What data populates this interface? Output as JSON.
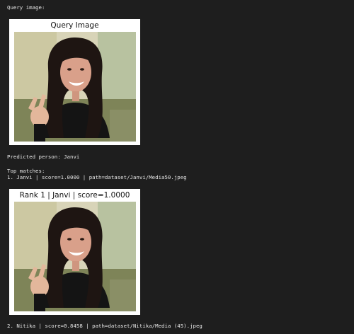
{
  "output": {
    "query_label": "Query image:",
    "query_figure": {
      "title": "Query Image",
      "photo": "portrait-woman-peace-sign"
    },
    "predicted": "Predicted person: Janvi",
    "top_matches_header": "Top matches:",
    "matches": [
      {
        "line": "1. Janvi | score=1.0000 | path=dataset/Janvi/Media50.jpeg",
        "figure_title": "Rank 1 | Janvi | score=1.0000",
        "photo": "portrait-woman-peace-sign"
      },
      {
        "line": "2. Nitika | score=0.8458 | path=dataset/Nitika/Media (45).jpeg"
      }
    ]
  }
}
